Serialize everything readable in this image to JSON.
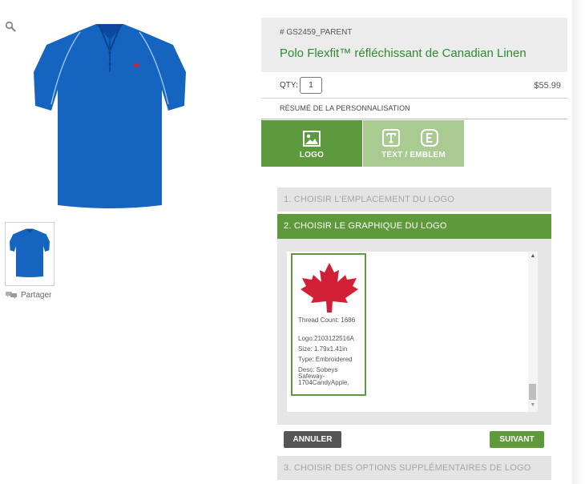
{
  "product": {
    "sku": "# GS2459_PARENT",
    "title": "Polo Flexfit™ réfléchissant de Canadian Linen",
    "qty_label": "QTY:",
    "qty_value": "1",
    "price": "$55.99",
    "summary_label": "RÉSUMÉ DE LA PERSONNALISATION"
  },
  "gallery": {
    "share_label": "Partager"
  },
  "tabs": [
    {
      "label": "LOGO",
      "active": true
    },
    {
      "label": "TEXT / EMBLEM",
      "active": false
    }
  ],
  "steps": {
    "step1": "1. CHOISIR L'EMPLACEMENT DU LOGO",
    "step2": "2. CHOISIR LE GRAPHIQUE DU LOGO",
    "step3": "3. CHOISIR DES OPTIONS SUPPLÉMENTAIRES DE LOGO"
  },
  "logo_card": {
    "thread_count": "Thread Count: 1686",
    "logo": "Logo:2103122516A",
    "size": "Size: 1.79x1.41in",
    "type": "Type: Embroidered",
    "desc": "Desc: Sobeys Safeway- 1704CandyApple,"
  },
  "buttons": {
    "cancel": "ANNULER",
    "next": "SUIVANT"
  },
  "colors": {
    "shirt": "#1565c0",
    "accent_green": "#5d9a3d",
    "light_green": "#a9cb92",
    "maple_red": "#d11f35"
  },
  "icons": [
    "search-icon",
    "image-icon",
    "text-icon",
    "emblem-icon",
    "speech-bubble-icon",
    "maple-leaf-icon"
  ]
}
